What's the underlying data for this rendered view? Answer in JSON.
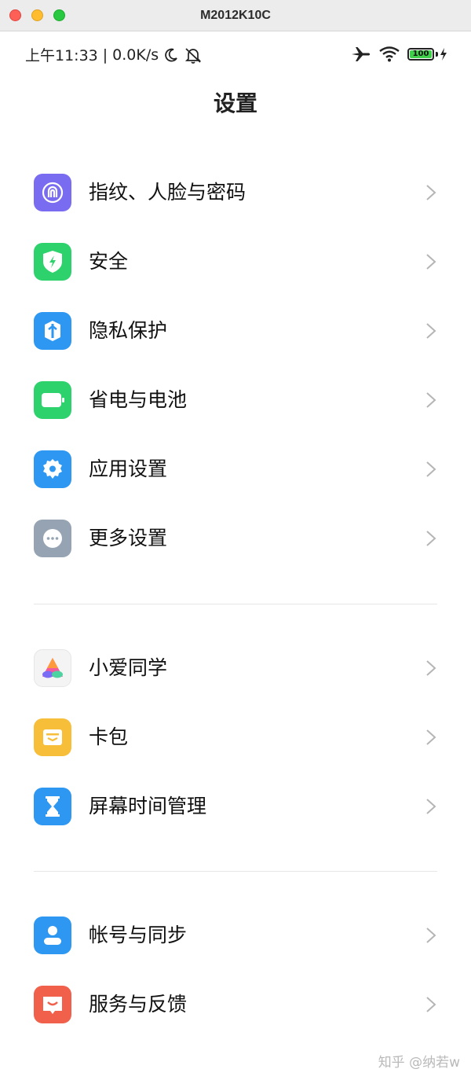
{
  "window": {
    "title": "M2012K10C"
  },
  "statusbar": {
    "time": "上午11:33",
    "separator": "|",
    "speed": "0.0K/s",
    "battery": "100"
  },
  "page": {
    "title": "设置"
  },
  "groups": [
    {
      "items": [
        {
          "label": "指纹、人脸与密码",
          "icon": "fingerprint-icon",
          "color": "#7a6cf0"
        },
        {
          "label": "安全",
          "icon": "shield-bolt-icon",
          "color": "#2ed26d"
        },
        {
          "label": "隐私保护",
          "icon": "privacy-icon",
          "color": "#2d97f2"
        },
        {
          "label": "省电与电池",
          "icon": "battery-icon",
          "color": "#2ed26d"
        },
        {
          "label": "应用设置",
          "icon": "gear-icon",
          "color": "#2d97f2"
        },
        {
          "label": "更多设置",
          "icon": "more-dots-icon",
          "color": "#95a3b3"
        }
      ]
    },
    {
      "items": [
        {
          "label": "小爱同学",
          "icon": "xiaoai-icon",
          "color": "#f2f2f2"
        },
        {
          "label": "卡包",
          "icon": "wallet-icon",
          "color": "#f7be3a"
        },
        {
          "label": "屏幕时间管理",
          "icon": "hourglass-icon",
          "color": "#2d97f2"
        }
      ]
    },
    {
      "items": [
        {
          "label": "帐号与同步",
          "icon": "account-icon",
          "color": "#2d97f2"
        },
        {
          "label": "服务与反馈",
          "icon": "service-feedback-icon",
          "color": "#f0604a"
        }
      ]
    }
  ],
  "watermark": "知乎 @纳若w"
}
